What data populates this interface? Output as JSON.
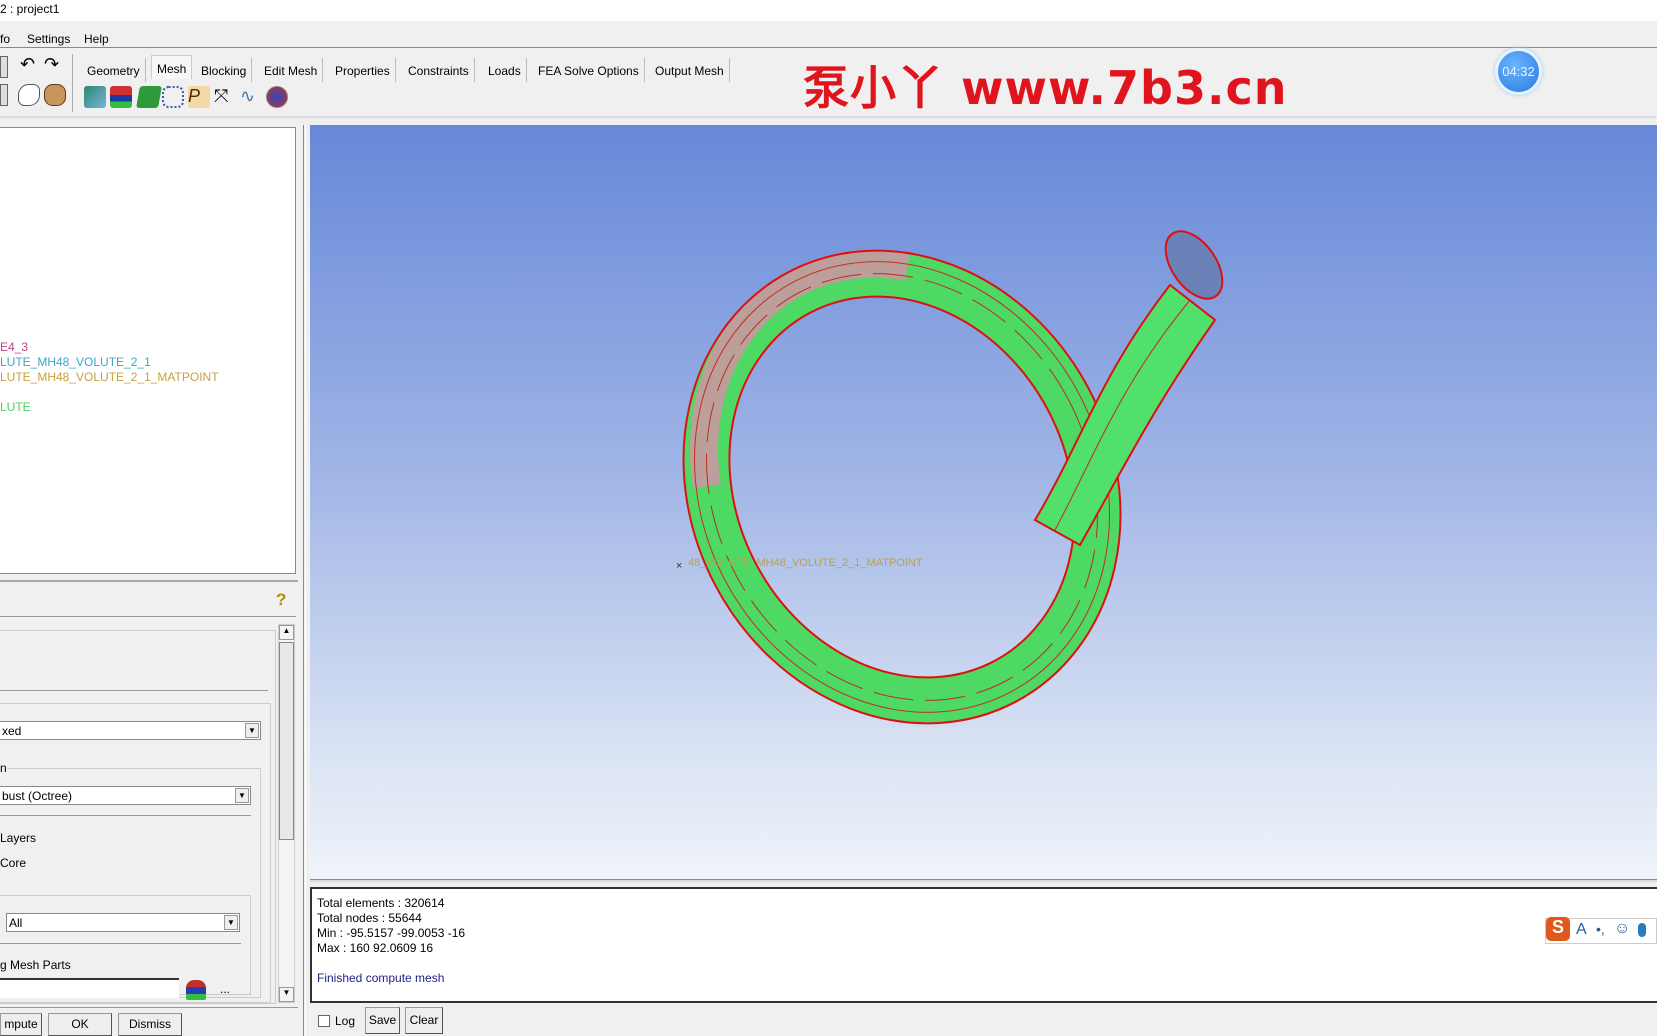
{
  "window": {
    "title": "2 : project1"
  },
  "menu": [
    "fo",
    "Settings",
    "Help"
  ],
  "tabs": [
    {
      "label": "Geometry"
    },
    {
      "label": "Mesh",
      "selected": true
    },
    {
      "label": "Blocking"
    },
    {
      "label": "Edit Mesh"
    },
    {
      "label": "Properties"
    },
    {
      "label": "Constraints"
    },
    {
      "label": "Loads"
    },
    {
      "label": "FEA Solve Options"
    },
    {
      "label": "Output Mesh"
    }
  ],
  "toolbar_icons": [
    "global-mesh-setup-icon",
    "part-mesh-setup-icon",
    "surface-mesh-setup-icon",
    "curve-mesh-setup-icon",
    "create-mesh-density-icon",
    "connectors-icon",
    "mesh-curve-icon",
    "compute-mesh-icon"
  ],
  "watermark": "泵小丫 www.7b3.cn",
  "timer": "04:32",
  "tree": {
    "items": [
      {
        "label": "E4_3",
        "color": "#c0408a"
      },
      {
        "label": "LUTE_MH48_VOLUTE_2_1",
        "color": "#3aa6c6"
      },
      {
        "label": "LUTE_MH48_VOLUTE_2_1_MATPOINT",
        "color": "#c8a040"
      },
      {
        "label": "LUTE",
        "color": "#4cd060"
      }
    ]
  },
  "panel": {
    "mesh_type": "xed",
    "method_group": "n",
    "method": "bust (Octree)",
    "opt1": "Layers",
    "opt2": "Core",
    "parts_select": "All",
    "parts_label": "g Mesh Parts",
    "more": "...",
    "buttons": {
      "compute": "mpute",
      "ok": "OK",
      "dismiss": "Dismiss"
    }
  },
  "viewport": {
    "label": "48_VOLUTE_MH48_VOLUTE_2_1_MATPOINT",
    "mesh_color": "#4ee06a",
    "edge_color": "#dd1010"
  },
  "log": {
    "lines": [
      "Total elements : 320614",
      "Total nodes : 55644",
      "Min : -95.5157 -99.0053 -16",
      "Max : 160 92.0609 16"
    ],
    "status": "Finished compute mesh",
    "log_label": "Log",
    "log_checked": false,
    "save": "Save",
    "clear": "Clear"
  }
}
